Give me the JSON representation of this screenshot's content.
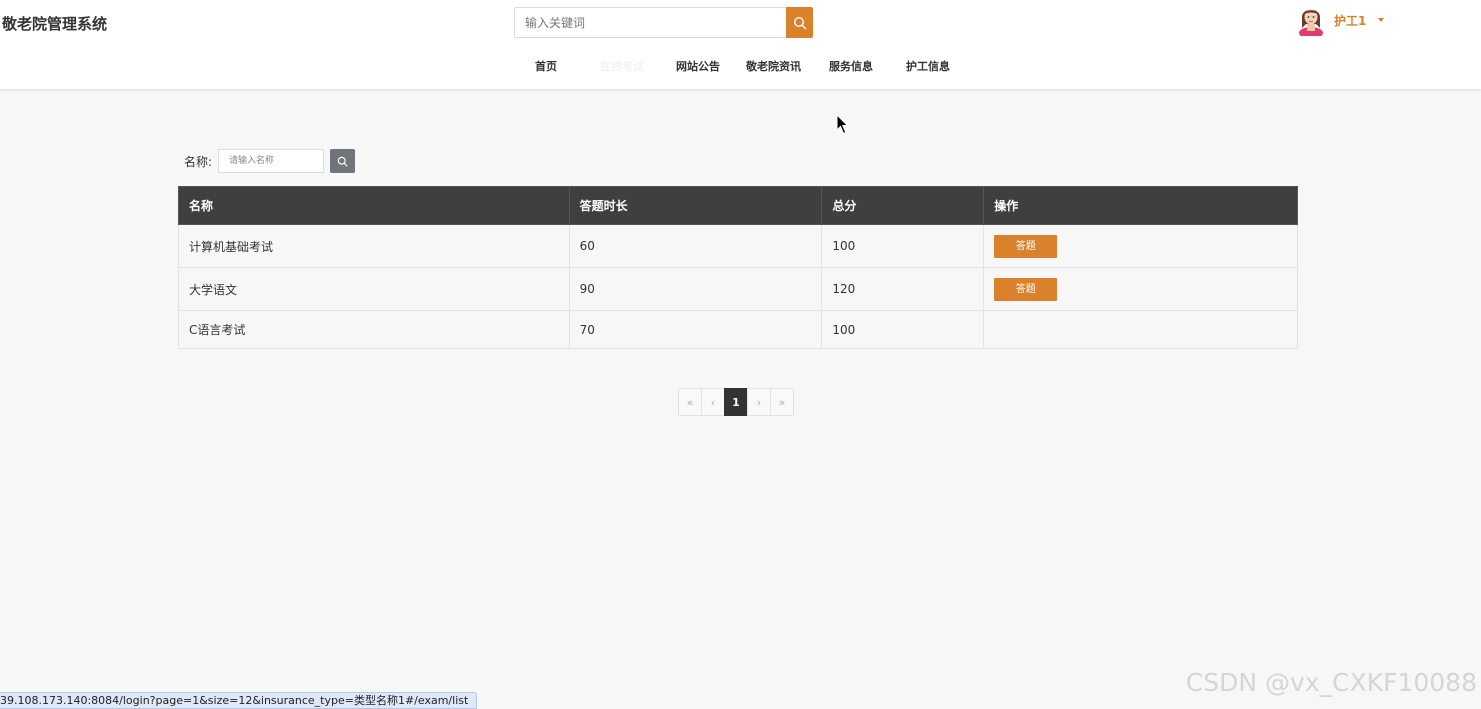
{
  "header": {
    "logo": "敬老院管理系统",
    "search_placeholder": "输入关键词",
    "user_name": "护工1"
  },
  "nav": [
    {
      "label": "首页"
    },
    {
      "label": "在线考试"
    },
    {
      "label": "网站公告"
    },
    {
      "label": "敬老院资讯"
    },
    {
      "label": "服务信息"
    },
    {
      "label": "护工信息"
    }
  ],
  "filter": {
    "label": "名称:",
    "placeholder": "请输入名称"
  },
  "table": {
    "headers": [
      "名称",
      "答题时长",
      "总分",
      "操作"
    ],
    "rows": [
      {
        "name": "计算机基础考试",
        "duration": "60",
        "score": "100",
        "action": "答题"
      },
      {
        "name": "大学语文",
        "duration": "90",
        "score": "120",
        "action": "答题"
      },
      {
        "name": "C语言考试",
        "duration": "70",
        "score": "100",
        "action": ""
      }
    ]
  },
  "pager": {
    "first": "«",
    "prev": "‹",
    "current": "1",
    "next": "›",
    "last": "»"
  },
  "status_url": "39.108.173.140:8084/login?page=1&size=12&insurance_type=类型名称1#/exam/list",
  "watermark": "CSDN @vx_CXKF10088",
  "colors": {
    "accent": "#d9822b",
    "table_header": "#3f3f3f",
    "search_button_gray": "#6f757b"
  }
}
